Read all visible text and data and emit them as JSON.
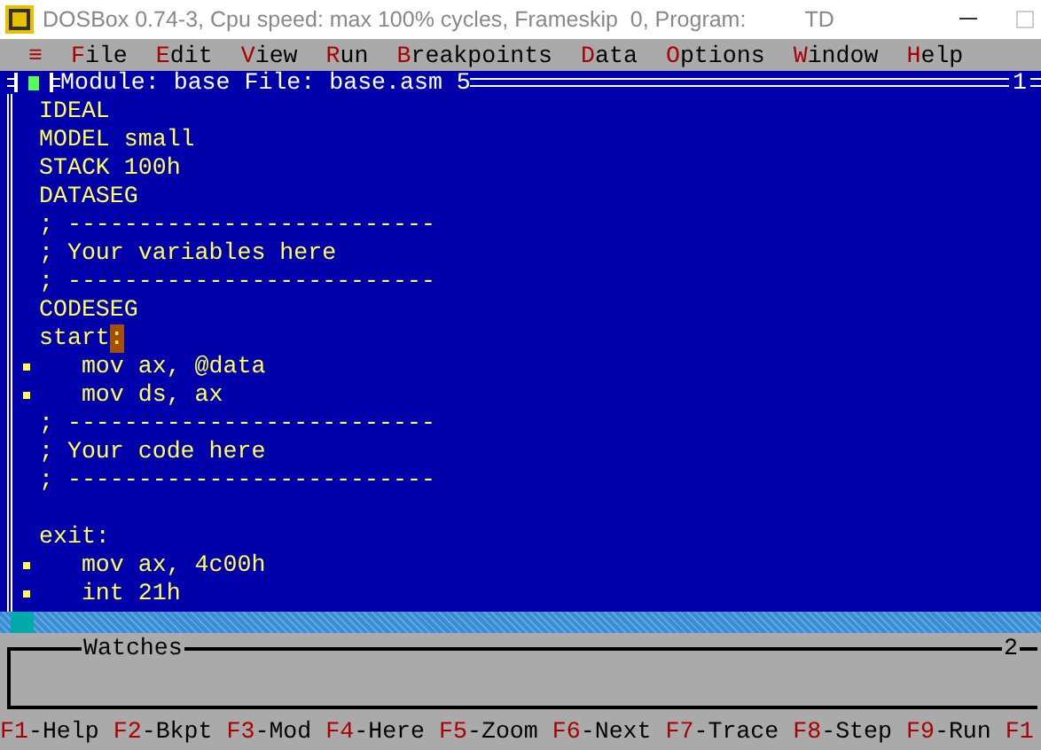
{
  "window": {
    "title": "DOSBox 0.74-3, Cpu speed: max 100% cycles, Frameskip  0, Program:",
    "program": "TD"
  },
  "menu": [
    {
      "label": "≡",
      "kind": "system"
    },
    {
      "label": "File",
      "kind": "item"
    },
    {
      "label": "Edit",
      "kind": "item"
    },
    {
      "label": "View",
      "kind": "item"
    },
    {
      "label": "Run",
      "kind": "item"
    },
    {
      "label": "Breakpoints",
      "kind": "item"
    },
    {
      "label": "Data",
      "kind": "item"
    },
    {
      "label": "Options",
      "kind": "item"
    },
    {
      "label": "Window",
      "kind": "item"
    },
    {
      "label": "Help",
      "kind": "item"
    }
  ],
  "module_window": {
    "title": "Module: base File: base.asm 5",
    "number": "1",
    "lines": [
      {
        "kind": "code",
        "text": "IDEAL",
        "marked": false
      },
      {
        "kind": "code",
        "text": "MODEL small",
        "marked": false
      },
      {
        "kind": "code",
        "text": "STACK 100h",
        "marked": false
      },
      {
        "kind": "code",
        "text": "DATASEG",
        "marked": false
      },
      {
        "kind": "code",
        "text": "; --------------------------",
        "marked": false
      },
      {
        "kind": "code",
        "text": "; Your variables here",
        "marked": false
      },
      {
        "kind": "code",
        "text": "; --------------------------",
        "marked": false
      },
      {
        "kind": "code",
        "text": "CODESEG",
        "marked": false
      },
      {
        "kind": "code",
        "text": "start",
        "cursor": ":",
        "marked": false
      },
      {
        "kind": "code",
        "text": "   mov ax, @data",
        "marked": true
      },
      {
        "kind": "code",
        "text": "   mov ds, ax",
        "marked": true
      },
      {
        "kind": "code",
        "text": "; --------------------------",
        "marked": false
      },
      {
        "kind": "code",
        "text": "; Your code here",
        "marked": false
      },
      {
        "kind": "code",
        "text": "; --------------------------",
        "marked": false
      },
      {
        "kind": "blank"
      },
      {
        "kind": "code",
        "text": "exit:",
        "marked": false
      },
      {
        "kind": "code",
        "text": "   mov ax, 4c00h",
        "marked": true
      },
      {
        "kind": "code",
        "text": "   int 21h",
        "marked": true
      }
    ]
  },
  "watches": {
    "title": "Watches",
    "number": "2"
  },
  "status_bar": [
    {
      "key": "F1",
      "label": "-Help"
    },
    {
      "key": "F2",
      "label": "-Bkpt"
    },
    {
      "key": "F3",
      "label": "-Mod"
    },
    {
      "key": "F4",
      "label": "-Here"
    },
    {
      "key": "F5",
      "label": "-Zoom"
    },
    {
      "key": "F6",
      "label": "-Next"
    },
    {
      "key": "F7",
      "label": "-Trace"
    },
    {
      "key": "F8",
      "label": "-Step"
    },
    {
      "key": "F9",
      "label": "-Run"
    },
    {
      "key": "F1"
    }
  ]
}
